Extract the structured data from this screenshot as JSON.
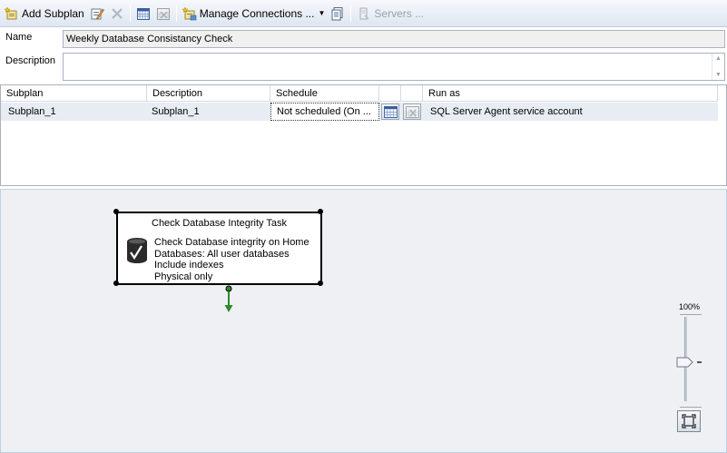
{
  "toolbar": {
    "add_subplan": "Add Subplan",
    "manage_connections": "Manage Connections ...",
    "servers": "Servers ..."
  },
  "form": {
    "name_label": "Name",
    "name_value": "Weekly Database Consistancy Check",
    "description_label": "Description",
    "description_value": ""
  },
  "grid": {
    "headers": [
      "Subplan",
      "Description",
      "Schedule",
      "",
      "",
      "Run as"
    ],
    "rows": [
      {
        "subplan": "Subplan_1",
        "description": "Subplan_1",
        "schedule": "Not scheduled (On ...",
        "run_as": "SQL Server Agent service account"
      }
    ]
  },
  "task": {
    "title": "Check Database Integrity Task",
    "lines": [
      "Check Database integrity on Home",
      "Databases: All user databases",
      "Include indexes",
      "Physical only"
    ]
  },
  "zoom": {
    "label": "100%",
    "level": 1.0
  },
  "colors": {
    "connector": "#2f8a2f",
    "selected_row": "#e8edf4",
    "surface": "#eef0f3"
  }
}
